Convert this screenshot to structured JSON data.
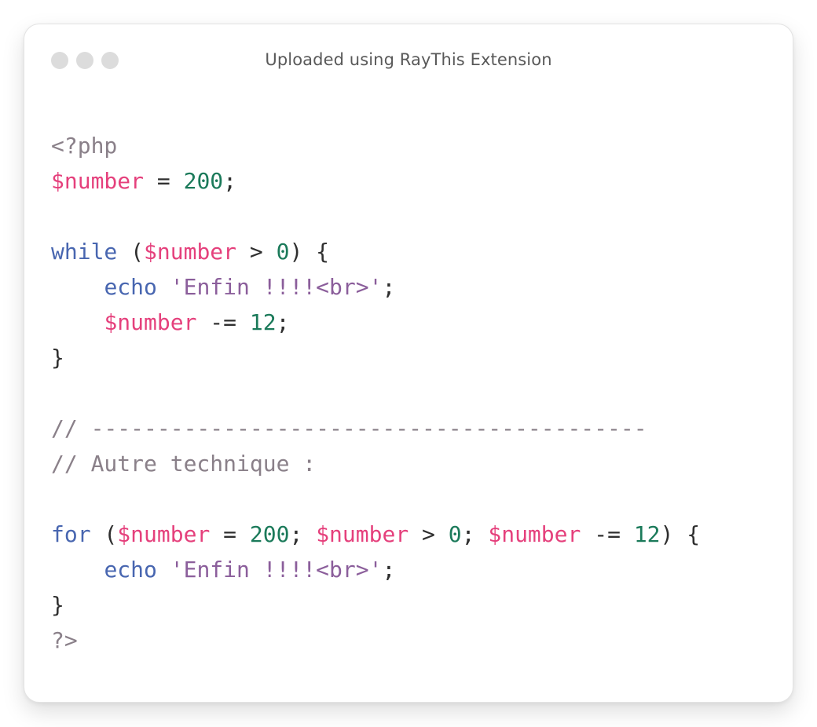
{
  "window": {
    "title": "Uploaded using RayThis Extension"
  },
  "code": {
    "lines": [
      [
        {
          "t": "<?php",
          "k": "meta"
        }
      ],
      [
        {
          "t": "$number",
          "k": "var"
        },
        {
          "t": " = ",
          "k": "op"
        },
        {
          "t": "200",
          "k": "num"
        },
        {
          "t": ";",
          "k": "op"
        }
      ],
      [],
      [
        {
          "t": "while",
          "k": "kw"
        },
        {
          "t": " (",
          "k": "op"
        },
        {
          "t": "$number",
          "k": "var"
        },
        {
          "t": " > ",
          "k": "op"
        },
        {
          "t": "0",
          "k": "num"
        },
        {
          "t": ") {",
          "k": "op"
        }
      ],
      [
        {
          "t": "    ",
          "k": "op"
        },
        {
          "t": "echo",
          "k": "kw"
        },
        {
          "t": " ",
          "k": "op"
        },
        {
          "t": "'Enfin !!!!<br>'",
          "k": "str"
        },
        {
          "t": ";",
          "k": "op"
        }
      ],
      [
        {
          "t": "    ",
          "k": "op"
        },
        {
          "t": "$number",
          "k": "var"
        },
        {
          "t": " -= ",
          "k": "op"
        },
        {
          "t": "12",
          "k": "num"
        },
        {
          "t": ";",
          "k": "op"
        }
      ],
      [
        {
          "t": "}",
          "k": "op"
        }
      ],
      [],
      [
        {
          "t": "// ------------------------------------------",
          "k": "cmt"
        }
      ],
      [
        {
          "t": "// Autre technique :",
          "k": "cmt"
        }
      ],
      [],
      [
        {
          "t": "for",
          "k": "kw"
        },
        {
          "t": " (",
          "k": "op"
        },
        {
          "t": "$number",
          "k": "var"
        },
        {
          "t": " = ",
          "k": "op"
        },
        {
          "t": "200",
          "k": "num"
        },
        {
          "t": "; ",
          "k": "op"
        },
        {
          "t": "$number",
          "k": "var"
        },
        {
          "t": " > ",
          "k": "op"
        },
        {
          "t": "0",
          "k": "num"
        },
        {
          "t": "; ",
          "k": "op"
        },
        {
          "t": "$number",
          "k": "var"
        },
        {
          "t": " -= ",
          "k": "op"
        },
        {
          "t": "12",
          "k": "num"
        },
        {
          "t": ") {",
          "k": "op"
        }
      ],
      [
        {
          "t": "    ",
          "k": "op"
        },
        {
          "t": "echo",
          "k": "kw"
        },
        {
          "t": " ",
          "k": "op"
        },
        {
          "t": "'Enfin !!!!<br>'",
          "k": "str"
        },
        {
          "t": ";",
          "k": "op"
        }
      ],
      [
        {
          "t": "}",
          "k": "op"
        }
      ],
      [
        {
          "t": "?>",
          "k": "meta"
        }
      ]
    ]
  },
  "colors": {
    "variable": "#e5407c",
    "number": "#1b7a5a",
    "keyword": "#4866b0",
    "string": "#8b5e9b",
    "comment": "#8a8089",
    "text": "#2f2f2f",
    "window_dot": "#dcdcdc"
  }
}
